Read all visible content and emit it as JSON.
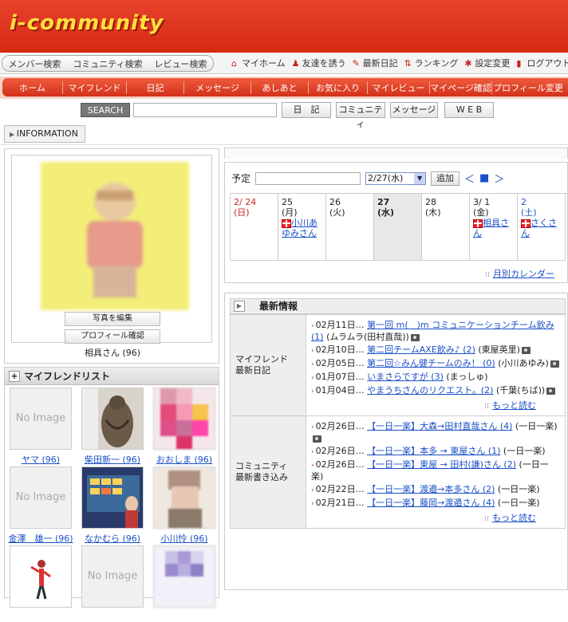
{
  "header": {
    "logo": "i-community"
  },
  "search_tabs": [
    "メンバー検索",
    "コミュニティ検索",
    "レビュー検索"
  ],
  "util_links": [
    {
      "icon": "home-icon",
      "label": "マイホーム"
    },
    {
      "icon": "person-icon",
      "label": "友達を誘う"
    },
    {
      "icon": "pencil-icon",
      "label": "最新日記"
    },
    {
      "icon": "ranking-icon",
      "label": "ランキング"
    },
    {
      "icon": "gear-icon",
      "label": "設定変更"
    },
    {
      "icon": "logout-icon",
      "label": "ログアウト"
    }
  ],
  "main_nav": [
    "ホーム",
    "マイフレンド",
    "日記",
    "メッセージ",
    "あしあと",
    "お気に入り",
    "マイレビュー",
    "マイページ確認",
    "プロフィール変更"
  ],
  "search": {
    "button": "SEARCH",
    "value": "",
    "targets": [
      "日　記",
      "コミュニティ",
      "メッセージ",
      "W E B"
    ]
  },
  "info_label": "INFORMATION",
  "profile": {
    "edit_photo": "写真を編集",
    "check_profile": "プロフィール確認",
    "name": "相具さん (96)"
  },
  "friend_list": {
    "title": "マイフレンドリスト",
    "no_image": "No Image",
    "friends": [
      {
        "name": "ヤマ (96)",
        "image": "none"
      },
      {
        "name": "柴田新一 (96)",
        "image": "cat"
      },
      {
        "name": "おおしま (96)",
        "image": "mosaic-pink"
      },
      {
        "name": "金澤　雄一 (96)",
        "image": "none"
      },
      {
        "name": "なかむら (96)",
        "image": "tv"
      },
      {
        "name": "小川怜 (96)",
        "image": "mosaic-face"
      },
      {
        "name": "",
        "image": "figure"
      },
      {
        "name": "",
        "image": "none"
      },
      {
        "name": "",
        "image": "mosaic-purple"
      }
    ]
  },
  "schedule": {
    "label": "予定",
    "input_value": "",
    "date_select": "2/27(水)",
    "add_button": "追加",
    "nav_prev": "＜",
    "nav_today": "■",
    "nav_next": "＞",
    "days": [
      {
        "date": "2/ 24",
        "wd": "(日)",
        "event": "",
        "color": "#cc2222"
      },
      {
        "date": "25",
        "wd": "(月)",
        "event": "小川あゆみさん",
        "color": "#222222"
      },
      {
        "date": "26",
        "wd": "(火)",
        "event": "",
        "color": "#222222"
      },
      {
        "date": "27",
        "wd": "(水)",
        "event": "",
        "color": "#222222"
      },
      {
        "date": "28",
        "wd": "(木)",
        "event": "",
        "color": "#222222"
      },
      {
        "date": "3/ 1",
        "wd": "(金)",
        "event": "相具さん",
        "color": "#222222"
      },
      {
        "date": "2",
        "wd": "(土)",
        "event": "さくさん",
        "color": "#1a4fc7"
      }
    ],
    "monthly_link": "月別カレンダー"
  },
  "news": {
    "title": "最新情報",
    "more": "もっと読む",
    "sections": [
      {
        "label": "マイフレンド\n最新日記",
        "items": [
          {
            "date": "02月11日…",
            "link": "第一回 m(＿)m コミュニケーションチーム飲み (1)",
            "author": "(ムラムラ(田村直哉))",
            "photo": true
          },
          {
            "date": "02月10日…",
            "link": "第二回チームAXE飲み♪ (2)",
            "author": "(東屋英里)",
            "photo": true
          },
          {
            "date": "02月05日…",
            "link": "第二回☆みん健チームのみ！ (0)",
            "author": "(小川あゆみ)",
            "photo": true
          },
          {
            "date": "01月07日…",
            "link": "いまさらですが (3)",
            "author": "(まっしゅ)",
            "photo": false
          },
          {
            "date": "01月04日…",
            "link": "やまうちさんのリクエスト。(2)",
            "author": "(千葉(ちば))",
            "photo": true
          }
        ]
      },
      {
        "label": "コミュニティ\n最新書き込み",
        "items": [
          {
            "date": "02月26日…",
            "link": "【一日一楽】大森→田村直哉さん (4)",
            "author": "(一日一楽)",
            "photo": true
          },
          {
            "date": "02月26日…",
            "link": "【一日一楽】本多 → 東屋さん (1)",
            "author": "(一日一楽)",
            "photo": false
          },
          {
            "date": "02月26日…",
            "link": "【一日一楽】東屋 → 田村(謙)さん (2)",
            "author": "(一日一楽)",
            "photo": false
          },
          {
            "date": "02月22日…",
            "link": "【一日一楽】渡邉→本多さん (2)",
            "author": "(一日一楽)",
            "photo": false
          },
          {
            "date": "02月21日…",
            "link": "【一日一楽】藤岡→渡邉さん (4)",
            "author": "(一日一楽)",
            "photo": false
          }
        ]
      }
    ]
  }
}
